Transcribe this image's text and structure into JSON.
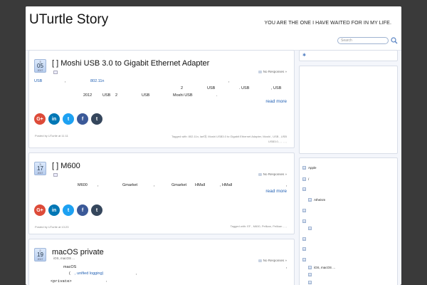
{
  "header": {
    "site_title": "UTurtle Story",
    "tagline": "YOU ARE THE ONE I HAVE WAITED FOR IN MY LIFE.",
    "search_placeholder": "Search"
  },
  "posts": [
    {
      "date": {
        "month": "3",
        "day": "05",
        "year": "2017"
      },
      "title": "[  ] Moshi USB 3.0 to Gigabit Ethernet Adapter",
      "responses": "No Responses »",
      "lines": [
        "USB",
        ",",
        "802.11n",
        ",",
        "2",
        "USB",
        ". USB",
        ", USB",
        "2012",
        "USB",
        "2",
        "USB",
        "Moshi USB",
        "."
      ],
      "read_more": "read more",
      "meta_left": "Posted by UTurtle at 11:11",
      "meta_right_1": "Tagged with: 802.11n, lan대, Moshi USB3.0 to Gigabit Ethernet Adapter, Moshi  , USB   ,   USB",
      "meta_right_2": "USB3.0,  ,  ,  ,  ,  ,  "
    },
    {
      "date": {
        "month": "3",
        "day": "17",
        "year": "2017"
      },
      "title": "[  ]      M600",
      "responses": "No Responses »",
      "lines": [
        "M600",
        ",",
        "Gmarket",
        ",",
        "Gmarket",
        "HMall",
        ", HMall",
        ","
      ],
      "read_more": "read more",
      "meta_left": "Posted by UTurtle at 13:23",
      "meta_right_1": "Tagged with: EF  , M600, Pellkan, Pelikan  ,  ,  ,  "
    },
    {
      "date": {
        "month": "2",
        "day": "19",
        "year": "2017"
      },
      "title": "macOS              private",
      "category": "iOS, macOS ...",
      "responses": "No Responses »",
      "lines": [
        "macOS",
        ",",
        "(",
        ", unified logging)",
        ",",
        "<private>",
        ","
      ]
    }
  ],
  "sidebar": {
    "tree": [
      {
        "label": "Apple",
        "indent": 0
      },
      {
        "label": "/",
        "indent": 1
      },
      {
        "label": "",
        "indent": 1
      },
      {
        "label": "Atheism",
        "indent": 2
      },
      {
        "label": "",
        "indent": 1
      },
      {
        "label": "",
        "indent": 1
      },
      {
        "label": "",
        "indent": 2
      },
      {
        "label": "",
        "indent": 1
      },
      {
        "label": "",
        "indent": 1
      },
      {
        "label": "",
        "indent": 1
      },
      {
        "label": "iOS, macOS ...",
        "indent": 2
      },
      {
        "label": "",
        "indent": 2
      },
      {
        "label": "",
        "indent": 2
      }
    ]
  },
  "social": {
    "colors": {
      "google": "#dd4b39",
      "linkedin": "#0077b5",
      "twitter": "#1da1f2",
      "facebook": "#3b5998",
      "tumblr": "#35465c"
    },
    "icons": [
      "google-plus-icon",
      "linkedin-icon",
      "twitter-icon",
      "facebook-icon",
      "tumblr-icon"
    ]
  }
}
